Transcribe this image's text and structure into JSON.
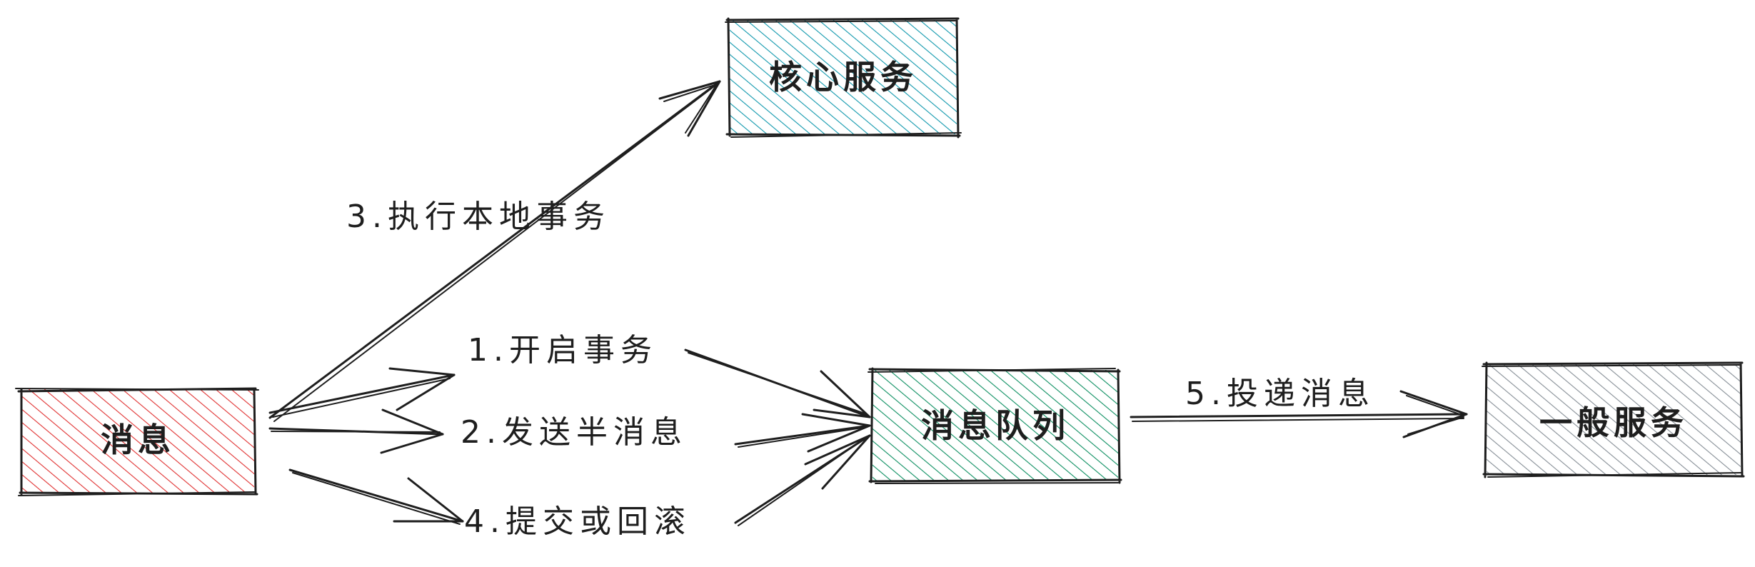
{
  "nodes": {
    "message": {
      "label": "消息",
      "color": "#e03131"
    },
    "core_service": {
      "label": "核心服务",
      "color": "#1098ad"
    },
    "message_queue": {
      "label": "消息队列",
      "color": "#0c8f61"
    },
    "general_service": {
      "label": "一般服务",
      "color": "#868e96"
    }
  },
  "edges": {
    "begin_transaction": "1.开启事务",
    "send_half_message": "2.发送半消息",
    "execute_local_transaction": "3.执行本地事务",
    "commit_or_rollback": "4.提交或回滚",
    "deliver_message": "5.投递消息"
  }
}
